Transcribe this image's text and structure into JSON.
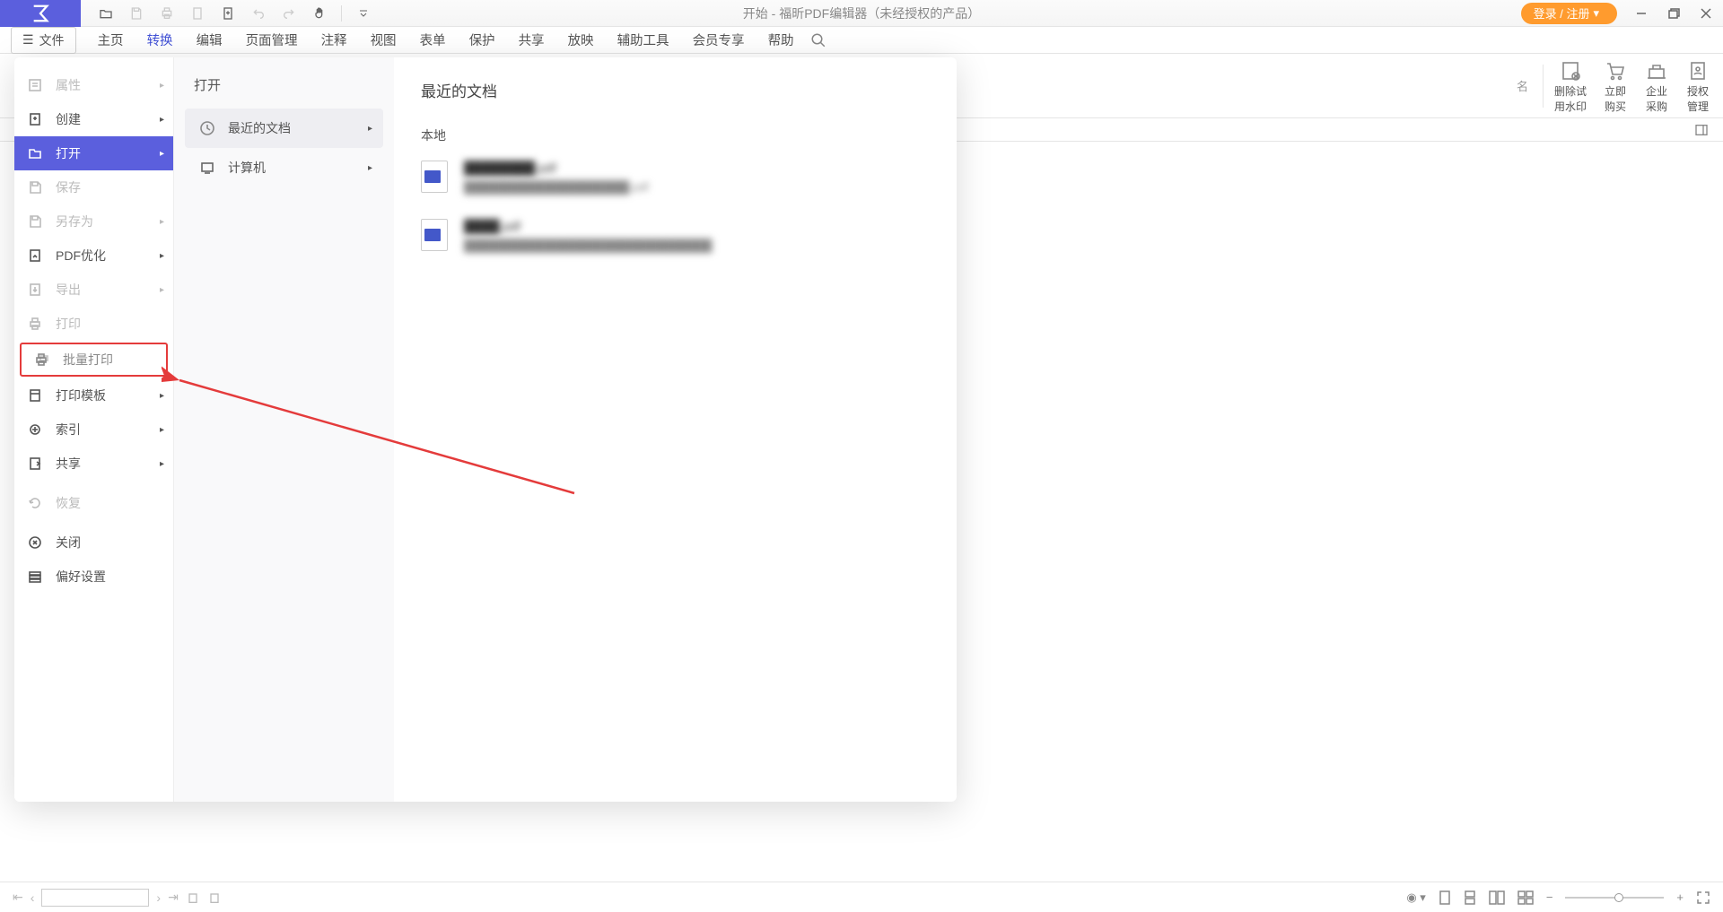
{
  "window_title": "开始 - 福昕PDF编辑器（未经授权的产品）",
  "login_button": "登录 / 注册",
  "file_button": "文件",
  "tabs": [
    "主页",
    "转换",
    "编辑",
    "页面管理",
    "注释",
    "视图",
    "表单",
    "保护",
    "共享",
    "放映",
    "辅助工具",
    "会员专享",
    "帮助"
  ],
  "active_tab_index": 1,
  "ribbon_tools": [
    {
      "line1": "删除试",
      "line2": "用水印"
    },
    {
      "line1": "立即",
      "line2": "购买"
    },
    {
      "line1": "企业",
      "line2": "采购"
    },
    {
      "line1": "授权",
      "line2": "管理"
    }
  ],
  "file_menu": {
    "items": [
      {
        "label": "属性",
        "disabled": true,
        "arrow": true
      },
      {
        "label": "创建",
        "arrow": true
      },
      {
        "label": "打开",
        "active": true,
        "arrow": true
      },
      {
        "label": "保存",
        "disabled": true
      },
      {
        "label": "另存为",
        "disabled": true,
        "arrow": true
      },
      {
        "label": "PDF优化",
        "arrow": true
      },
      {
        "label": "导出",
        "disabled": true,
        "arrow": true
      },
      {
        "label": "打印",
        "disabled": true
      },
      {
        "label": "批量打印",
        "highlight": true
      },
      {
        "label": "打印模板",
        "arrow": true
      },
      {
        "label": "索引",
        "arrow": true
      },
      {
        "label": "共享",
        "arrow": true
      },
      {
        "label": "恢复",
        "disabled": true
      },
      {
        "label": "关闭"
      },
      {
        "label": "偏好设置"
      }
    ],
    "col2_title": "打开",
    "col2_items": [
      {
        "label": "最近的文档",
        "selected": true,
        "arrow": true
      },
      {
        "label": "计算机",
        "arrow": true
      }
    ],
    "col3_title": "最近的文档",
    "col3_section": "本地",
    "docs": [
      {
        "name": "████████.pdf",
        "path": "████████████████████.pdf"
      },
      {
        "name": "████.pdf",
        "path": "██████████████████████████████"
      }
    ]
  },
  "zoom_right_label": "名"
}
